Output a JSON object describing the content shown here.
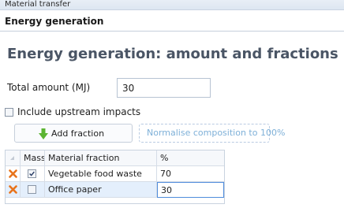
{
  "breadcrumb": "Material transfer",
  "section_title": "Energy generation",
  "page_title": "Energy generation: amount and fractions",
  "total_amount": {
    "label": "Total amount (MJ)",
    "value": "30"
  },
  "upstream": {
    "label": "Include upstream impacts",
    "checked": false
  },
  "buttons": {
    "add_fraction": "Add fraction",
    "normalise": "Normalise composition to 100%"
  },
  "table": {
    "headers": [
      "Mass",
      "Material fraction",
      "%"
    ],
    "rows": [
      {
        "mass_checked": true,
        "material": "Vegetable food waste",
        "percent": "70"
      },
      {
        "mass_checked": false,
        "material": "Office paper",
        "percent": "30"
      }
    ]
  },
  "colors": {
    "delete_icon": "#e8731b",
    "add_arrow": "#5bb432",
    "title": "#4a5565"
  },
  "icons": {
    "add": "arrow-down-icon",
    "delete": "delete-x-icon",
    "check": "checkmark-icon"
  }
}
